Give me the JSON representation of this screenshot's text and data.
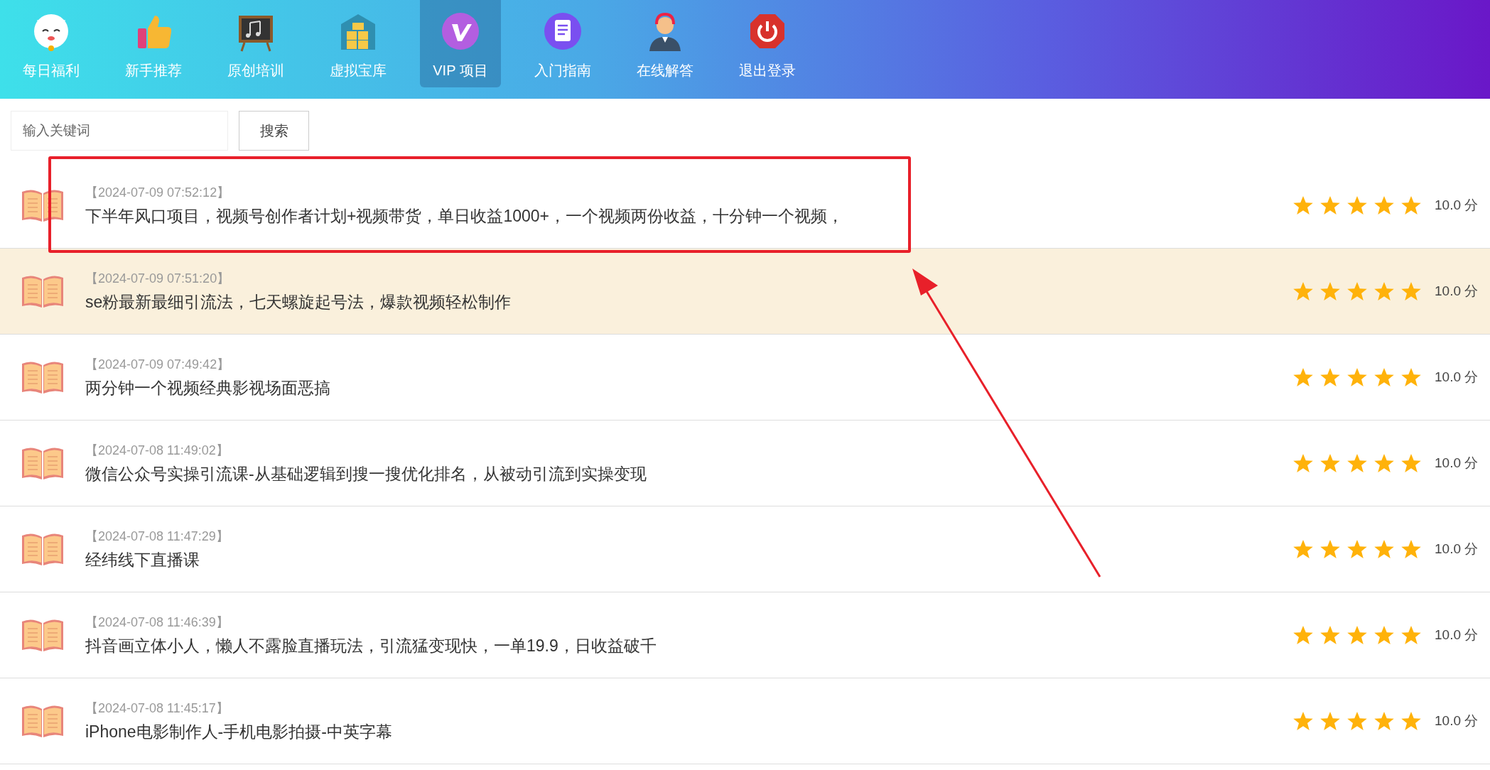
{
  "nav": [
    {
      "kind": "cat",
      "label": "每日福利",
      "selected": false
    },
    {
      "kind": "thumb",
      "label": "新手推荐",
      "selected": false
    },
    {
      "kind": "board",
      "label": "原创培训",
      "selected": false
    },
    {
      "kind": "boxes",
      "label": "虚拟宝库",
      "selected": false
    },
    {
      "kind": "vip",
      "label": "VIP 项目",
      "selected": true
    },
    {
      "kind": "doc",
      "label": "入门指南",
      "selected": false
    },
    {
      "kind": "agent",
      "label": "在线解答",
      "selected": false
    },
    {
      "kind": "power",
      "label": "退出登录",
      "selected": false
    }
  ],
  "search": {
    "placeholder": "输入关键词",
    "button": "搜索"
  },
  "items": [
    {
      "date": "【2024-07-09 07:52:12】",
      "title": "下半年风口项目，视频号创作者计划+视频带货，单日收益1000+，一个视频两份收益，十分钟一个视频，",
      "stars": 5,
      "score": "10.0 分",
      "highlighted": false,
      "annotated": true
    },
    {
      "date": "【2024-07-09 07:51:20】",
      "title": "se粉最新最细引流法，七天螺旋起号法，爆款视频轻松制作",
      "stars": 5,
      "score": "10.0 分",
      "highlighted": true,
      "annotated": false
    },
    {
      "date": "【2024-07-09 07:49:42】",
      "title": "两分钟一个视频经典影视场面恶搞",
      "stars": 5,
      "score": "10.0 分",
      "highlighted": false,
      "annotated": false
    },
    {
      "date": "【2024-07-08 11:49:02】",
      "title": "微信公众号实操引流课-从基础逻辑到搜一搜优化排名，从被动引流到实操变现",
      "stars": 5,
      "score": "10.0 分",
      "highlighted": false,
      "annotated": false
    },
    {
      "date": "【2024-07-08 11:47:29】",
      "title": "经纬线下直播课",
      "stars": 5,
      "score": "10.0 分",
      "highlighted": false,
      "annotated": false
    },
    {
      "date": "【2024-07-08 11:46:39】",
      "title": "抖音画立体小人，懒人不露脸直播玩法，引流猛变现快，一单19.9，日收益破千",
      "stars": 5,
      "score": "10.0 分",
      "highlighted": false,
      "annotated": false
    },
    {
      "date": "【2024-07-08 11:45:17】",
      "title": "iPhone电影制作人-手机电影拍摄-中英字幕",
      "stars": 5,
      "score": "10.0 分",
      "highlighted": false,
      "annotated": false
    }
  ]
}
